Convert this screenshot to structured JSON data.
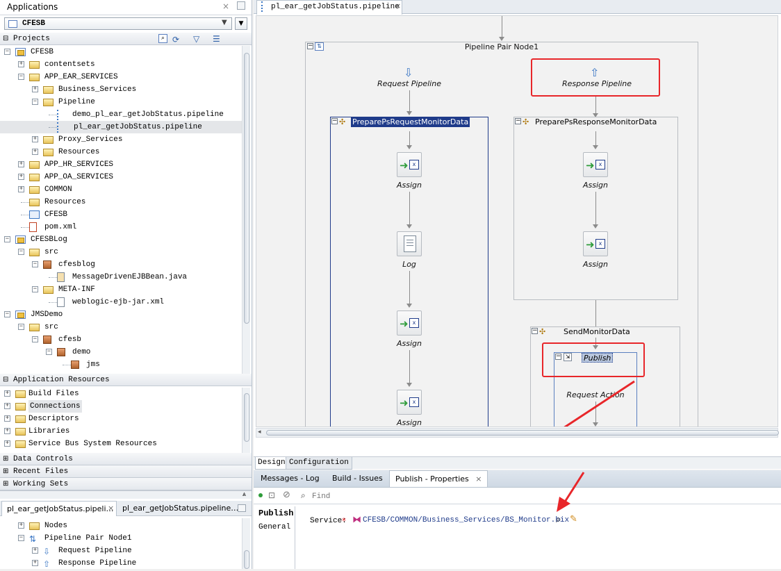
{
  "applications": {
    "title": "Applications",
    "app_selector": "CFESB",
    "projects_label": "Projects"
  },
  "project_tree": [
    {
      "label": "CFESB",
      "level": 0,
      "icon": "project-icon",
      "expander": "−"
    },
    {
      "label": "contentsets",
      "level": 1,
      "icon": "folder-icon",
      "expander": "+"
    },
    {
      "label": "APP_EAR_SERVICES",
      "level": 1,
      "icon": "folder-icon",
      "expander": "−"
    },
    {
      "label": "Business_Services",
      "level": 2,
      "icon": "folder-icon",
      "expander": "+"
    },
    {
      "label": "Pipeline",
      "level": 2,
      "icon": "folder-icon",
      "expander": "−"
    },
    {
      "label": "demo_pl_ear_getJobStatus.pipeline",
      "level": 3,
      "icon": "pipeline-file-icon",
      "expander": ""
    },
    {
      "label": "pl_ear_getJobStatus.pipeline",
      "level": 3,
      "icon": "pipeline-file-icon",
      "expander": "",
      "selected": true
    },
    {
      "label": "Proxy_Services",
      "level": 2,
      "icon": "folder-icon",
      "expander": "+"
    },
    {
      "label": "Resources",
      "level": 2,
      "icon": "folder-icon",
      "expander": "+"
    },
    {
      "label": "APP_HR_SERVICES",
      "level": 1,
      "icon": "folder-icon",
      "expander": "+"
    },
    {
      "label": "APP_OA_SERVICES",
      "level": 1,
      "icon": "folder-icon",
      "expander": "+"
    },
    {
      "label": "COMMON",
      "level": 1,
      "icon": "folder-icon",
      "expander": "+"
    },
    {
      "label": "Resources",
      "level": 1,
      "icon": "folder-icon",
      "expander": ""
    },
    {
      "label": "CFESB",
      "level": 1,
      "icon": "service-bus-icon",
      "expander": ""
    },
    {
      "label": "pom.xml",
      "level": 1,
      "icon": "maven-file-icon",
      "expander": ""
    },
    {
      "label": "CFESBLog",
      "level": 0,
      "icon": "project-icon",
      "expander": "−"
    },
    {
      "label": "src",
      "level": 1,
      "icon": "folder-icon",
      "expander": "−"
    },
    {
      "label": "cfesblog",
      "level": 2,
      "icon": "package-icon",
      "expander": "−"
    },
    {
      "label": "MessageDrivenEJBBean.java",
      "level": 3,
      "icon": "java-file-icon",
      "expander": ""
    },
    {
      "label": "META-INF",
      "level": 2,
      "icon": "folder-icon",
      "expander": "−"
    },
    {
      "label": "weblogic-ejb-jar.xml",
      "level": 3,
      "icon": "xml-file-icon",
      "expander": ""
    },
    {
      "label": "JMSDemo",
      "level": 0,
      "icon": "project-icon",
      "expander": "−"
    },
    {
      "label": "src",
      "level": 1,
      "icon": "folder-icon",
      "expander": "−"
    },
    {
      "label": "cfesb",
      "level": 2,
      "icon": "package-icon",
      "expander": "−"
    },
    {
      "label": "demo",
      "level": 3,
      "icon": "package-icon",
      "expander": "−"
    },
    {
      "label": "jms",
      "level": 4,
      "icon": "package-icon",
      "expander": ""
    }
  ],
  "app_resources": {
    "title": "Application Resources",
    "items": [
      "Build Files",
      "Connections",
      "Descriptors",
      "Libraries",
      "Service Bus System Resources"
    ]
  },
  "collapsed_panels": [
    "Data Controls",
    "Recent Files",
    "Working Sets"
  ],
  "structure_tabs": [
    "pl_ear_getJobStatus.pipeli…",
    "pl_ear_getJobStatus.pipeline…"
  ],
  "structure_tree": [
    {
      "label": "Nodes",
      "level": 1
    },
    {
      "label": "Pipeline Pair Node1",
      "level": 1
    },
    {
      "label": "Request Pipeline",
      "level": 2
    },
    {
      "label": "Response Pipeline",
      "level": 2
    }
  ],
  "editor": {
    "tab_label": "pl_ear_getJobStatus.pipeline",
    "pipeline_pair": "Pipeline Pair Node1",
    "request_pipeline": "Request Pipeline",
    "response_pipeline": "Response Pipeline",
    "request_stage": "PreparePsRequestMonitorData",
    "response_stage": "PreparePsResponseMonitorData",
    "send_stage": "SendMonitorData",
    "publish": "Publish",
    "request_action": "Request Action",
    "assign": "Assign",
    "log": "Log",
    "bottom_tabs": [
      "Design",
      "Configuration"
    ]
  },
  "bottom_panel": {
    "tabs": [
      "Messages - Log",
      "Build - Issues",
      "Publish - Properties"
    ],
    "find_placeholder": "Find",
    "side_items": [
      "Publish",
      "General"
    ],
    "service_label": "Service:",
    "required_mark": "*",
    "service_value": "CFESB/COMMON/Business_Services/BS_Monitor.bix"
  },
  "colors": {
    "highlight_red": "#e8262a",
    "selection_blue": "#1f3b8a",
    "accent_blue": "#3a76c4"
  }
}
